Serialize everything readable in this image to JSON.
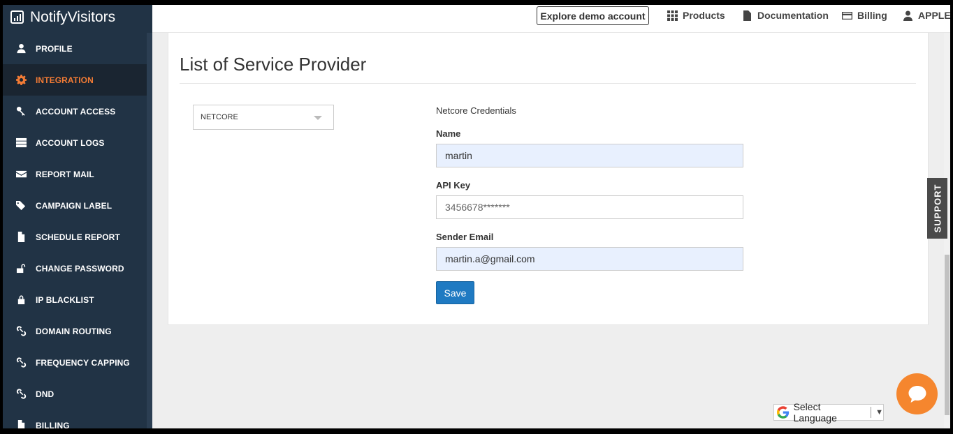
{
  "brand": {
    "name": "NotifyVisitors"
  },
  "sidebar": {
    "items": [
      {
        "label": "PROFILE",
        "icon": "user-icon",
        "active": false
      },
      {
        "label": "INTEGRATION",
        "icon": "gear-icon",
        "active": true
      },
      {
        "label": "ACCOUNT ACCESS",
        "icon": "key-icon",
        "active": false
      },
      {
        "label": "ACCOUNT LOGS",
        "icon": "server-icon",
        "active": false
      },
      {
        "label": "REPORT MAIL",
        "icon": "envelope-icon",
        "active": false
      },
      {
        "label": "CAMPAIGN LABEL",
        "icon": "tags-icon",
        "active": false
      },
      {
        "label": "SCHEDULE REPORT",
        "icon": "file-icon",
        "active": false
      },
      {
        "label": "CHANGE PASSWORD",
        "icon": "unlock-icon",
        "active": false
      },
      {
        "label": "IP BLACKLIST",
        "icon": "lock-icon",
        "active": false
      },
      {
        "label": "DOMAIN ROUTING",
        "icon": "link-icon",
        "active": false
      },
      {
        "label": "FREQUENCY CAPPING",
        "icon": "link-icon",
        "active": false
      },
      {
        "label": "DND",
        "icon": "link-icon",
        "active": false
      },
      {
        "label": "BILLING",
        "icon": "file-icon",
        "active": false
      }
    ]
  },
  "topbar": {
    "demo_button": "Explore demo account",
    "products": "Products",
    "documentation": "Documentation",
    "billing": "Billing",
    "user": "APPLE"
  },
  "main": {
    "title": "List of Service Provider",
    "provider_select": "NETCORE",
    "credentials_title": "Netcore Credentials",
    "name_label": "Name",
    "name_value": "martin",
    "api_key_label": "API Key",
    "api_key_value": "3456678*******",
    "sender_email_label": "Sender Email",
    "sender_email_value": "martin.a@gmail.com",
    "save_label": "Save"
  },
  "support_tab": "SUPPORT",
  "language": {
    "label": "Select Language",
    "arrow": "▼"
  },
  "colors": {
    "sidebar_bg": "#213345",
    "accent": "#f27b35",
    "primary_button": "#1f7ac2",
    "chat_bubble": "#f5862e"
  }
}
